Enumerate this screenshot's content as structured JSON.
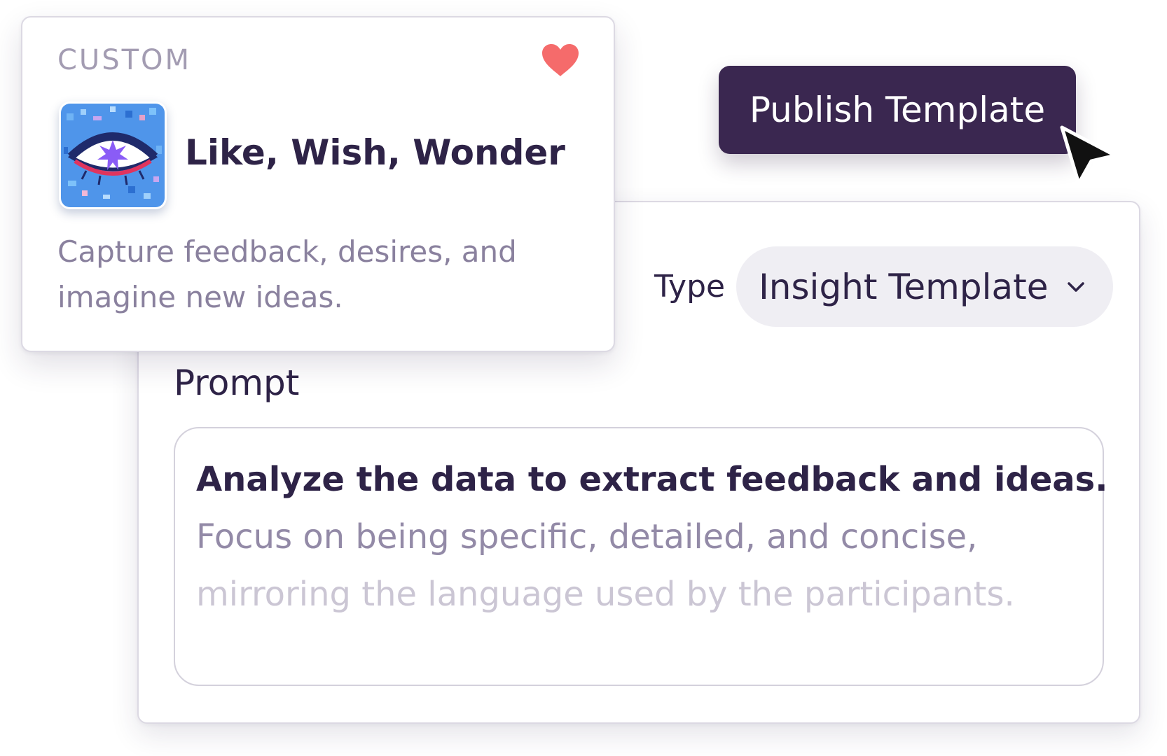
{
  "colors": {
    "primary_dark": "#3a2750",
    "text_dark": "#2e2347",
    "text_muted": "#8a819e",
    "heart": "#f56b6b",
    "select_bg": "#efeef3"
  },
  "custom_card": {
    "eyebrow": "CUSTOM",
    "favorite_icon": "heart-icon",
    "thumbnail_icon": "eye-illustration",
    "title": "Like, Wish, Wonder",
    "description": "Capture feedback, desires, and imagine new ideas."
  },
  "toolbar": {
    "publish_label": "Publish Template",
    "cursor_icon": "mouse-pointer-icon"
  },
  "editor": {
    "type_label": "Type",
    "type_value": "Insight Template",
    "type_dropdown_icon": "chevron-down-icon",
    "prompt_label": "Prompt",
    "prompt_lines": [
      "Analyze the data to extract feedback and ideas.",
      "Focus on being specific, detailed, and concise,",
      "mirroring the language used by the participants."
    ]
  }
}
